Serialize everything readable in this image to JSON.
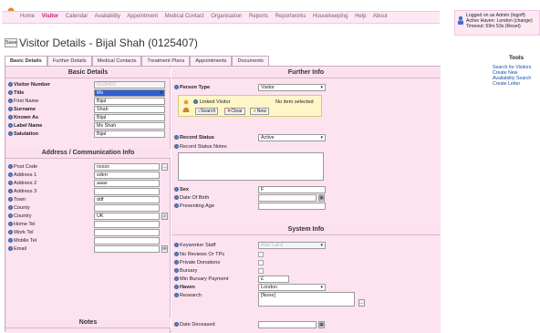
{
  "nav": {
    "items": [
      "Home",
      "Visitor",
      "Calendar",
      "Availability",
      "Appointment",
      "Medical Contact",
      "Organisation",
      "Reports",
      "Reportworks",
      "Housekeeping",
      "Help",
      "About"
    ],
    "active_index": 1
  },
  "login": {
    "line1": "Logged on as Admin (logoff)",
    "line2": "Active Haven: London (change)",
    "line3": "Timeout: 59m 53s (Reset)"
  },
  "page": {
    "save_label": "Save",
    "title": "Visitor Details - Bijal Shah (0125407)"
  },
  "tabs": [
    "Basic Details",
    "Further Details",
    "Medical Contacts",
    "Treatment Plans",
    "Appointments",
    "Documents"
  ],
  "basic": {
    "title": "Basic Details",
    "visitor_number_label": "Visitor Number",
    "visitor_number": "0125407",
    "title_label": "Title",
    "title_value": "Ms",
    "first_name_label": "First Name",
    "first_name": "Bijal",
    "surname_label": "Surname",
    "surname": "Shah",
    "known_as_label": "Known As",
    "known_as": "Bijal",
    "label_name_label": "Label Name",
    "label_name": "Ms  Shah",
    "salutation_label": "Salutation",
    "salutation": "Bijal"
  },
  "address": {
    "title": "Address / Communication Info",
    "post_code_label": "Post Code",
    "post_code": "nxxxx",
    "address1_label": "Address 1",
    "address1": "sderr",
    "address2_label": "Address 2",
    "address2": "aaax",
    "address3_label": "Address 3",
    "address3": "",
    "town_label": "Town",
    "town": "ddf",
    "county_label": "County",
    "county": "",
    "country_label": "Country",
    "country": "UK",
    "home_tel_label": "Home Tel",
    "home_tel": "",
    "work_tel_label": "Work Tel",
    "work_tel": "",
    "mobile_tel_label": "Mobile Tel",
    "mobile_tel": "",
    "email_label": "Email",
    "email": ""
  },
  "notes": {
    "title": "Notes"
  },
  "further": {
    "title": "Further Info",
    "person_type_label": "Person Type",
    "person_type": "Visitor",
    "linked_visitor_label": "Linked Visitor",
    "no_item": "No item selected",
    "search_label": "Search",
    "clear_label": "Clear",
    "new_label": "New",
    "record_status_label": "Record Status",
    "record_status": "Active",
    "record_status_notes_label": "Record Status Notes",
    "sex_label": "Sex",
    "sex": "F",
    "dob_label": "Date Of Birth",
    "dob": "",
    "presenting_age_label": "Presenting Age",
    "presenting_age": ""
  },
  "system": {
    "title": "System Info",
    "keyworker_label": "Keyworker Staff",
    "keyworker": "Alex Laird",
    "no_reviews_label": "No Reviews Or TPs",
    "private_donations_label": "Private Donations",
    "bursary_label": "Bursary",
    "min_bursary_label": "Min Bursary Payment",
    "min_bursary": "£",
    "haven_label": "Haven",
    "haven": "London",
    "research_label": "Research",
    "research": "[None]",
    "date_deceased_label": "Date Deceased"
  },
  "tools": {
    "title": "Tools",
    "links": [
      "Search for Visitors",
      "Create New",
      "Availability Search",
      "Create Letter"
    ]
  },
  "colors": {
    "accent": "#cc1177",
    "panel": "#fde2f0",
    "nav_bg": "#fde8f4"
  }
}
